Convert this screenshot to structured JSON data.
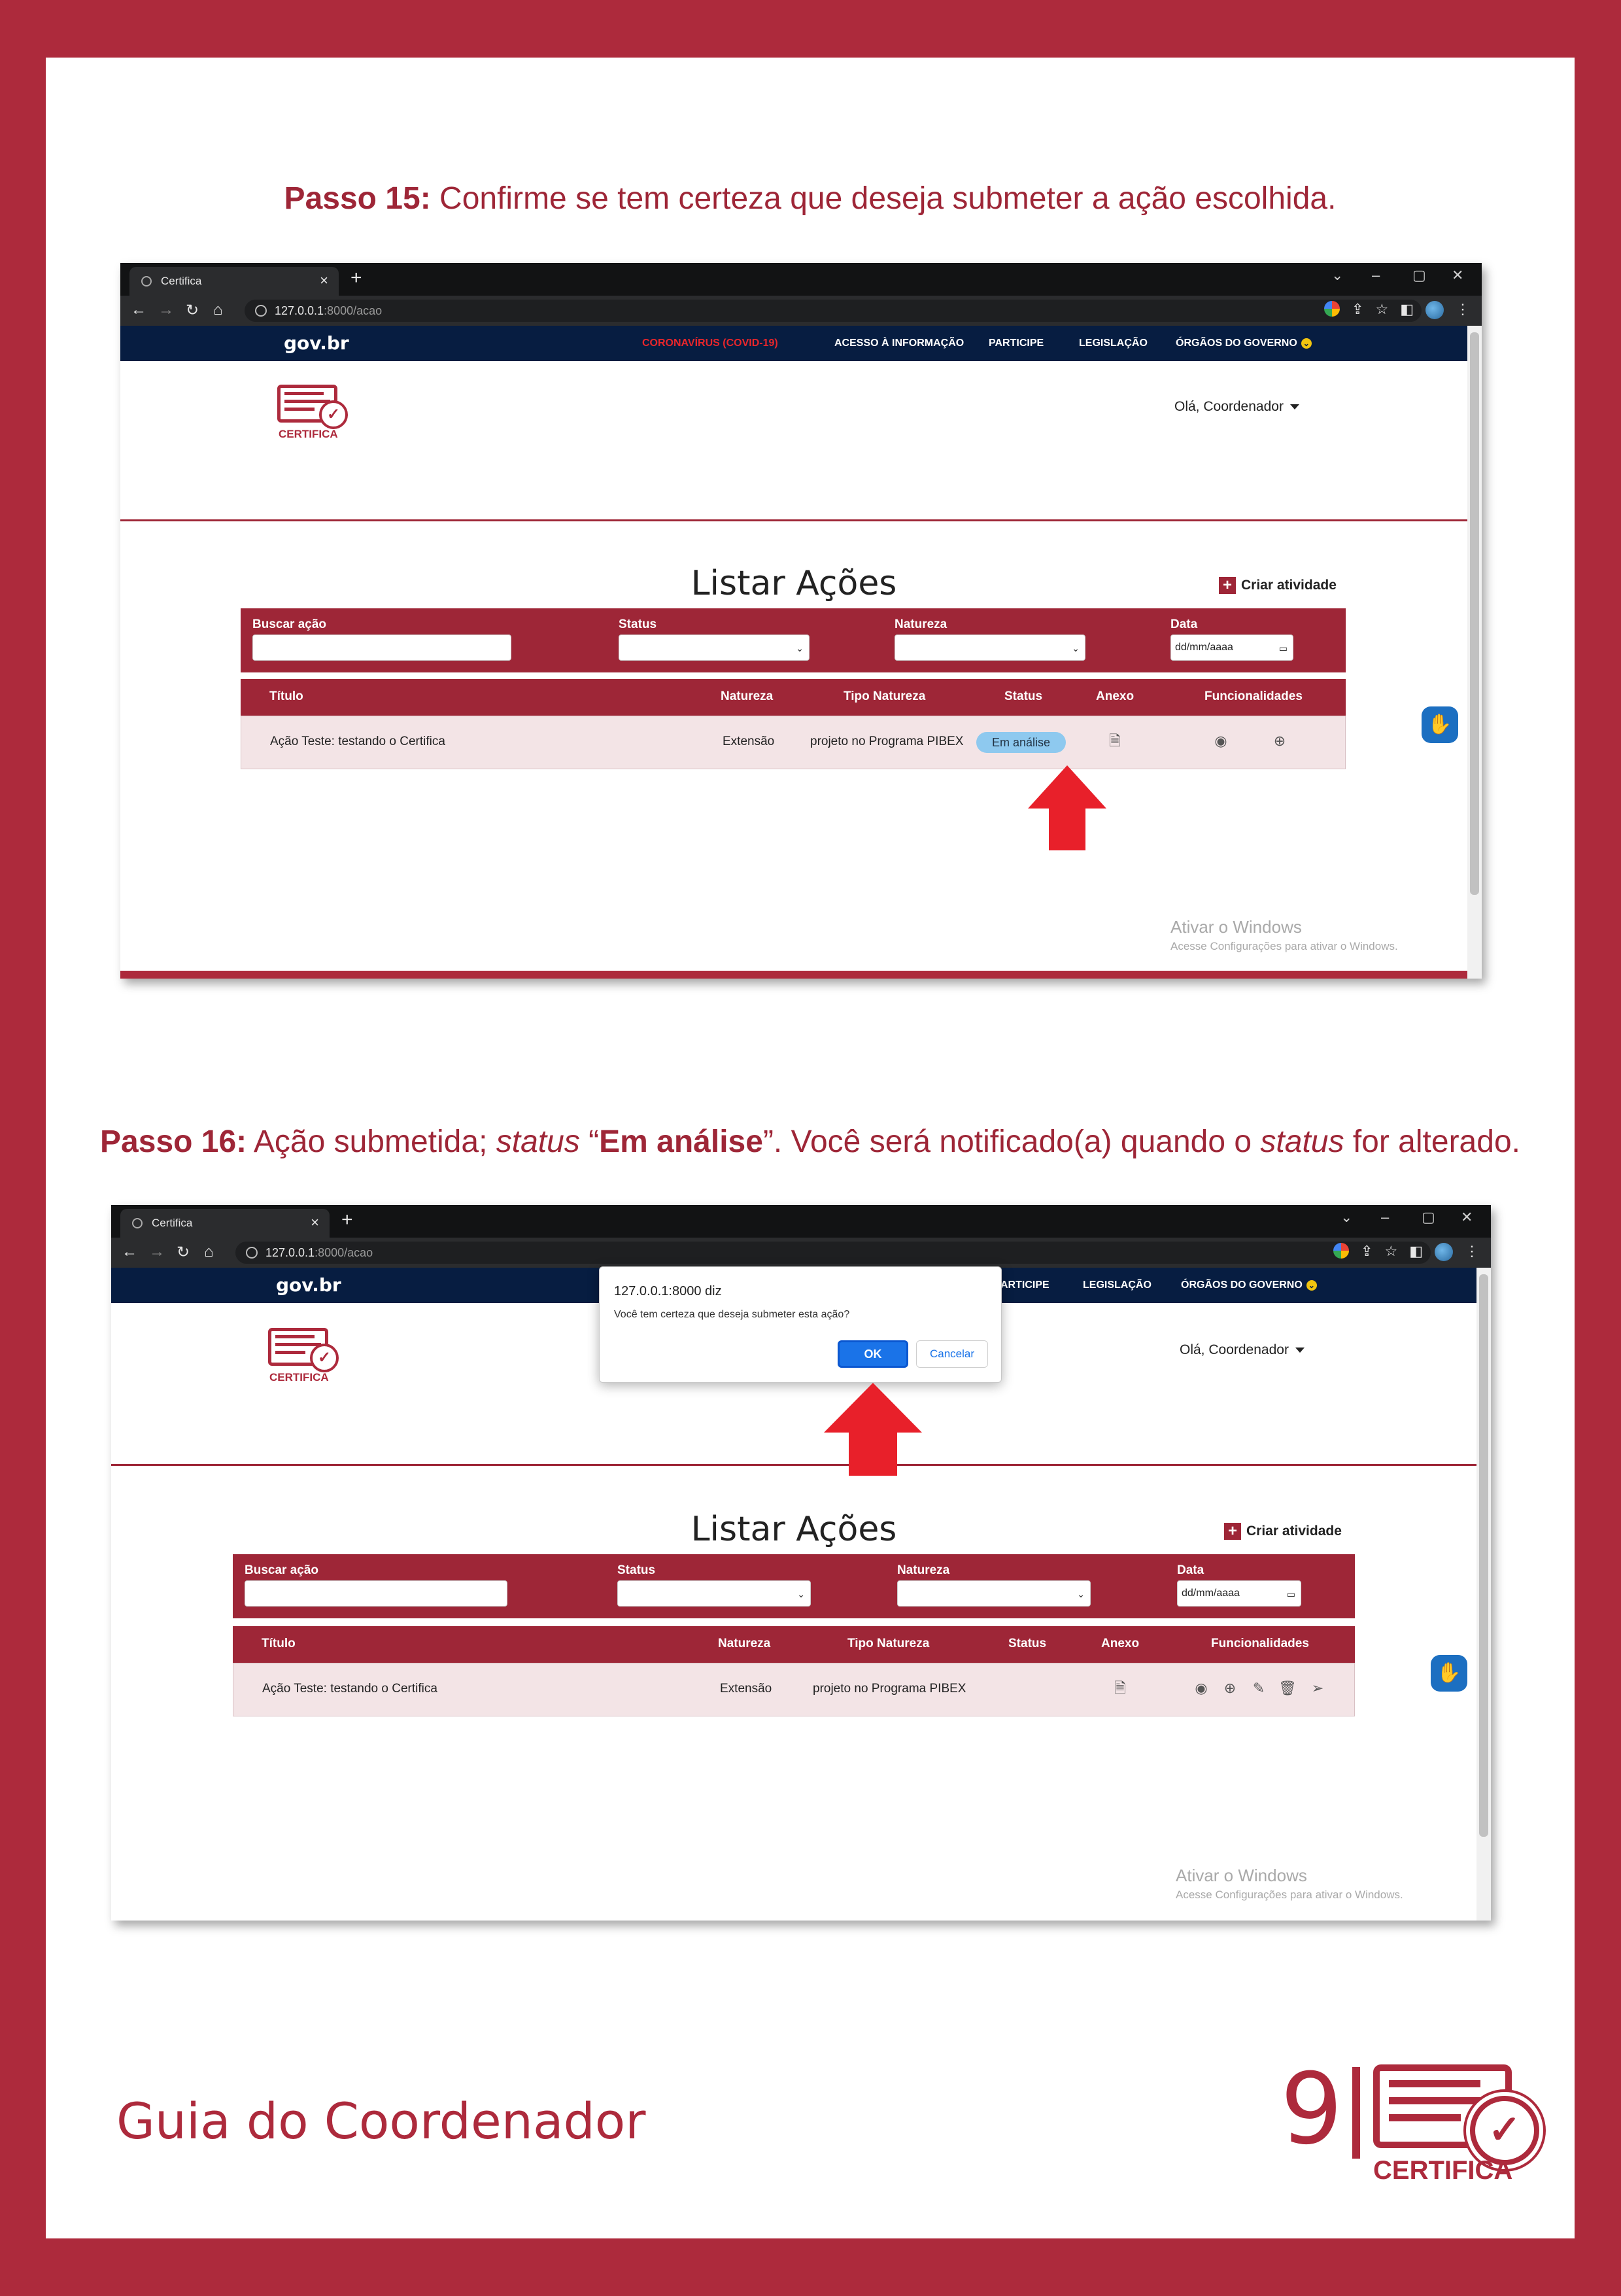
{
  "steps": [
    {
      "label": "Passo 15:",
      "text": "Confirme se tem certeza que deseja submeter a ação escolhida."
    },
    {
      "label": "Passo 16:",
      "parts": [
        "Ação submetida; ",
        "status",
        " “",
        "Em análise",
        "”. Você será notificado(a) quando o ",
        "status",
        " for alterado."
      ]
    }
  ],
  "browser": {
    "tab_title": "Certifica",
    "url_host": "127.0.0.1",
    "url_path": ":8000/acao"
  },
  "gov_bar": {
    "logo": "gov.br",
    "links": [
      "CORONAVÍRUS (COVID-19)",
      "ACESSO À INFORMAÇÃO",
      "PARTICIPE",
      "LEGISLAÇÃO",
      "ÓRGÃOS DO GOVERNO"
    ],
    "links_partial": [
      "ARTICIPE",
      "LEGISLAÇÃO",
      "ÓRGÃOS DO GOVERNO"
    ]
  },
  "site": {
    "logo_text": "CERTIFICA",
    "user_greeting": "Olá, Coordenador",
    "page_title": "Listar Ações",
    "create_button": "Criar atividade",
    "filters": {
      "search_label": "Buscar ação",
      "status_label": "Status",
      "nature_label": "Natureza",
      "date_label": "Data",
      "date_placeholder": "dd/mm/aaaa"
    },
    "table": {
      "headers": [
        "Título",
        "Natureza",
        "Tipo Natureza",
        "Status",
        "Anexo",
        "Funcionalidades"
      ],
      "row": {
        "title": "Ação Teste: testando o Certifica",
        "nature": "Extensão",
        "nature_type": "projeto no Programa PIBEX",
        "status": "Em análise"
      }
    }
  },
  "windows_watermark": {
    "line1": "Ativar o Windows",
    "line2": "Acesse Configurações para ativar o Windows."
  },
  "dialog": {
    "origin": "127.0.0.1:8000 diz",
    "message": "Você tem certeza que deseja submeter esta ação?",
    "ok": "OK",
    "cancel": "Cancelar"
  },
  "footer": {
    "title": "Guia do Coordenador",
    "page_number": "9",
    "logo_text": "CERTIFICA"
  },
  "colors": {
    "brand": "#ad2a3c",
    "brand_dark": "#9e2637",
    "gov_navy": "#071d41",
    "badge": "#8ec9ef",
    "ok_blue": "#1a73e8",
    "arrow_red": "#e8202a"
  },
  "icons": [
    "globe-favicon",
    "close-icon",
    "plus-icon",
    "back-icon",
    "forward-icon",
    "reload-icon",
    "home-icon",
    "info-icon",
    "google-icon",
    "share-icon",
    "star-icon",
    "sidepanel-icon",
    "profile-icon",
    "menu-icon",
    "eye-icon",
    "plus-circle-icon",
    "file-icon",
    "pencil-icon",
    "trash-icon",
    "send-icon",
    "accessibility-icon",
    "check-seal-icon",
    "red-arrow-up"
  ]
}
